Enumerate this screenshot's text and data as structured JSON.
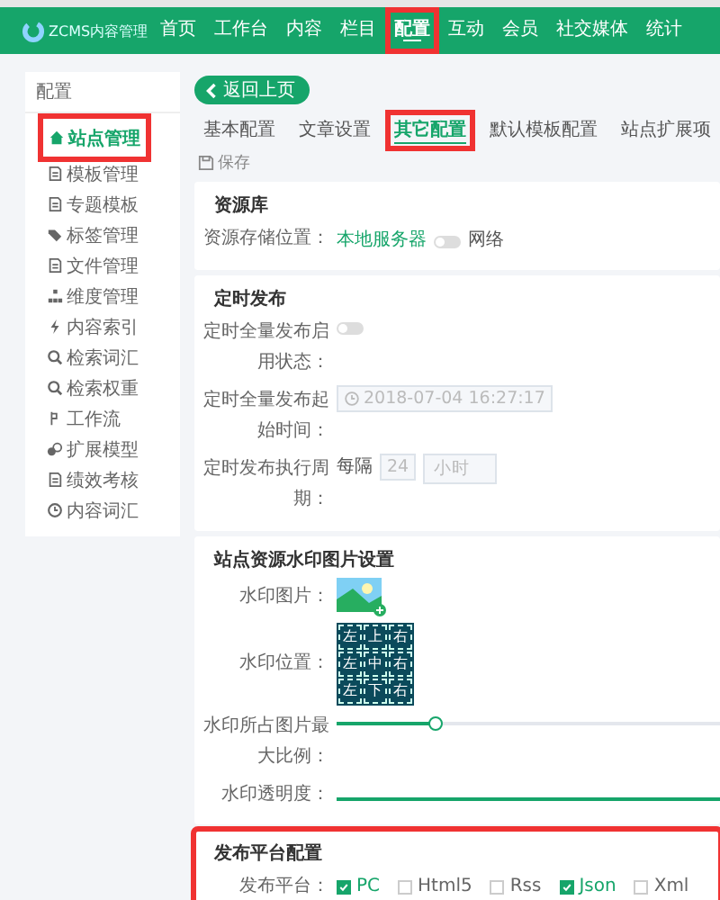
{
  "brand": "ZCMS内容管理",
  "nav": [
    {
      "label": "首页",
      "selected": false,
      "highlighted": false
    },
    {
      "label": "工作台",
      "selected": false,
      "highlighted": false
    },
    {
      "label": "内容",
      "selected": false,
      "highlighted": false
    },
    {
      "label": "栏目",
      "selected": false,
      "highlighted": false
    },
    {
      "label": "配置",
      "selected": true,
      "highlighted": true
    },
    {
      "label": "互动",
      "selected": false,
      "highlighted": false
    },
    {
      "label": "会员",
      "selected": false,
      "highlighted": false
    },
    {
      "label": "社交媒体",
      "selected": false,
      "highlighted": false
    },
    {
      "label": "统计",
      "selected": false,
      "highlighted": false
    }
  ],
  "sidebar": {
    "title": "配置",
    "items": [
      {
        "label": "站点管理",
        "kind": "home",
        "selected": true,
        "highlighted": true
      },
      {
        "label": "模板管理",
        "kind": "doc",
        "selected": false,
        "highlighted": false
      },
      {
        "label": "专题模板",
        "kind": "doc",
        "selected": false,
        "highlighted": false
      },
      {
        "label": "标签管理",
        "kind": "tag",
        "selected": false,
        "highlighted": false
      },
      {
        "label": "文件管理",
        "kind": "doc",
        "selected": false,
        "highlighted": false
      },
      {
        "label": "维度管理",
        "kind": "tree",
        "selected": false,
        "highlighted": false
      },
      {
        "label": "内容索引",
        "kind": "bolt",
        "selected": false,
        "highlighted": false
      },
      {
        "label": "检索词汇",
        "kind": "search",
        "selected": false,
        "highlighted": false
      },
      {
        "label": "检索权重",
        "kind": "search",
        "selected": false,
        "highlighted": false
      },
      {
        "label": "工作流",
        "kind": "flow",
        "selected": false,
        "highlighted": false
      },
      {
        "label": "扩展模型",
        "kind": "cubes",
        "selected": false,
        "highlighted": false
      },
      {
        "label": "绩效考核",
        "kind": "doc",
        "selected": false,
        "highlighted": false
      },
      {
        "label": "内容词汇",
        "kind": "clock",
        "selected": false,
        "highlighted": false
      }
    ]
  },
  "back_button": "返回上页",
  "tabs": [
    {
      "label": "基本配置",
      "selected": false,
      "highlighted": false
    },
    {
      "label": "文章设置",
      "selected": false,
      "highlighted": false
    },
    {
      "label": "其它配置",
      "selected": true,
      "highlighted": true
    },
    {
      "label": "默认模板配置",
      "selected": false,
      "highlighted": false
    },
    {
      "label": "站点扩展项",
      "selected": false,
      "highlighted": false
    }
  ],
  "save_button": "保存",
  "resource": {
    "title": "资源库",
    "label": "资源存储位置：",
    "option_left": "本地服务器",
    "option_right": "网络",
    "on": false
  },
  "schedule": {
    "title": "定时发布",
    "enable_label": "定时全量发布启用状态：",
    "enabled": false,
    "start_label": "定时全量发布起始时间：",
    "start_value": "2018-07-04 16:27:17",
    "period_label": "定时发布执行周期：",
    "every": "每隔",
    "interval": "24",
    "unit": "小时"
  },
  "watermark": {
    "title": "站点资源水印图片设置",
    "image_label": "水印图片：",
    "position_label": "水印位置：",
    "positions": [
      "左",
      "上",
      "右",
      "左",
      "中",
      "右",
      "左",
      "下",
      "右"
    ],
    "ratio_label": "水印所占图片最大比例：",
    "ratio": {
      "level": 0.26
    },
    "opacity_label": "水印透明度：",
    "opacity": {
      "level": 1
    }
  },
  "publish": {
    "title": "发布平台配置",
    "label": "发布平台：",
    "highlighted": true,
    "platforms": [
      {
        "label": "PC",
        "checked": true
      },
      {
        "label": "Html5",
        "checked": false
      },
      {
        "label": "Rss",
        "checked": false
      },
      {
        "label": "Json",
        "checked": true
      },
      {
        "label": "Xml",
        "checked": false
      }
    ]
  }
}
